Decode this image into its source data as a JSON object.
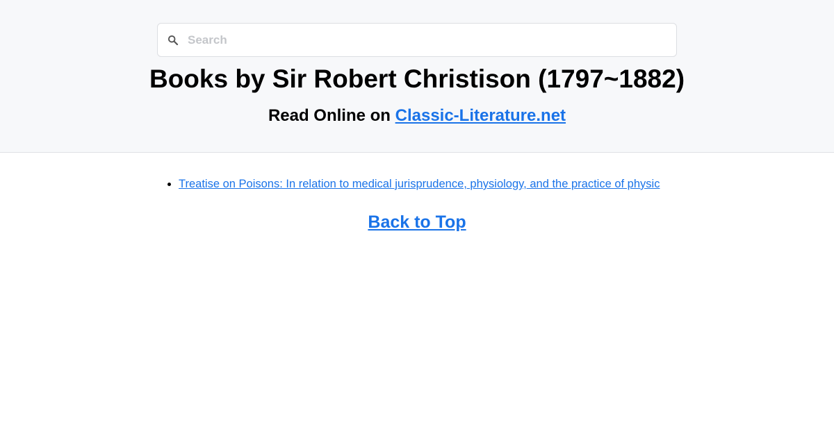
{
  "search": {
    "placeholder": "Search",
    "value": "",
    "icon": "search-icon"
  },
  "header": {
    "title": "Books by Sir Robert Christison (1797~1882)",
    "subtitle_prefix": "Read Online on ",
    "subtitle_link": "Classic-Literature.net"
  },
  "books": [
    "Treatise on Poisons: In relation to medical jurisprudence, physiology, and the practice of physic"
  ],
  "footer": {
    "back_to_top": "Back to Top"
  },
  "colors": {
    "link": "#1a73e8",
    "header_bg": "#f7f8fa",
    "text": "#000000"
  }
}
